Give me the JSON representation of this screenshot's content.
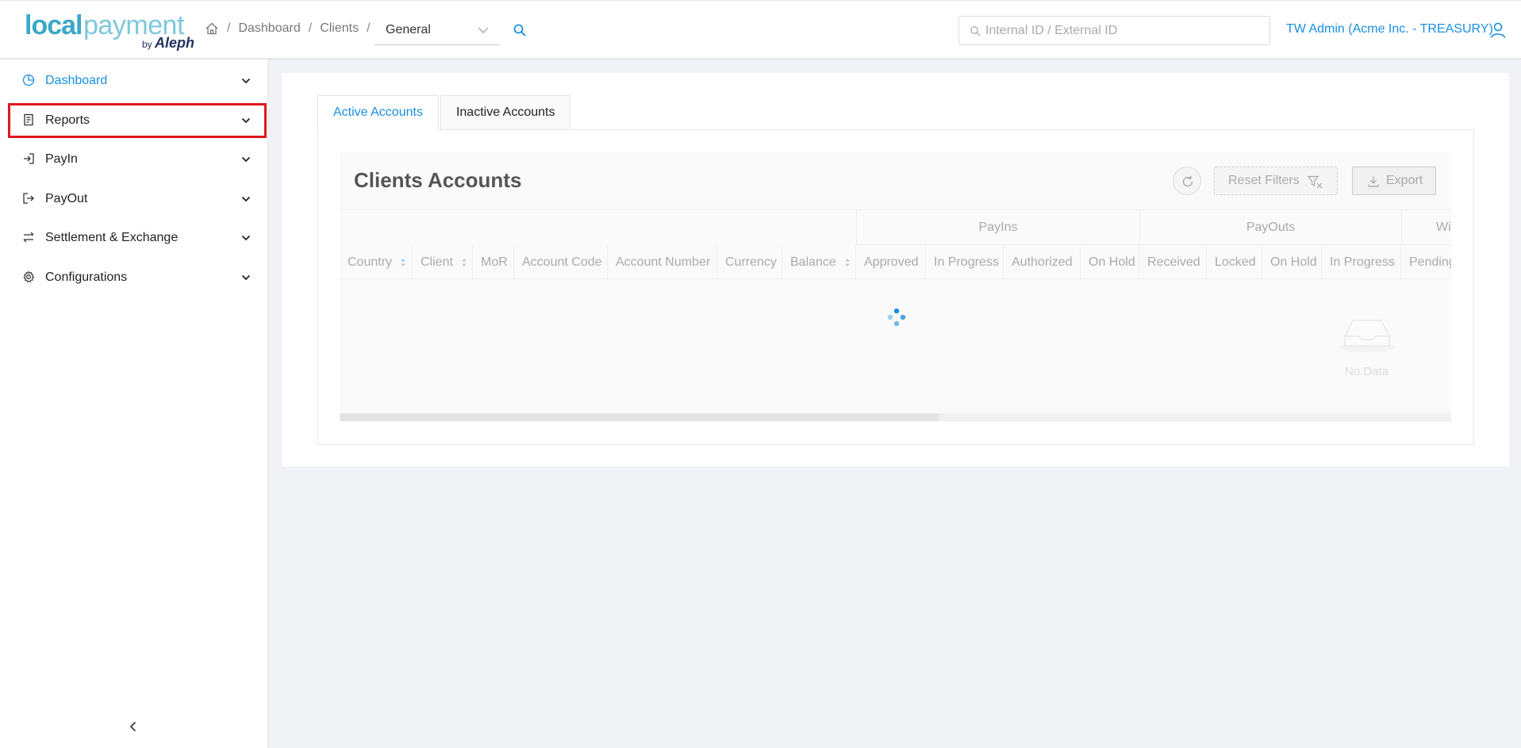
{
  "app": {
    "logo": {
      "local": "local",
      "payment": "payment",
      "by": "by",
      "aleph": "Aleph"
    }
  },
  "header": {
    "breadcrumb": [
      "Dashboard",
      "Clients"
    ],
    "breadcrumb_separator": "/",
    "dropdown_value": "General",
    "id_search_placeholder": "Internal ID / External ID",
    "user": "TW Admin (Acme Inc. - TREASURY)"
  },
  "sidebar": {
    "items": [
      {
        "label": "Dashboard",
        "icon": "pie-chart-icon",
        "active": true
      },
      {
        "label": "Reports",
        "icon": "report-icon",
        "highlighted": true
      },
      {
        "label": "PayIn",
        "icon": "login-icon"
      },
      {
        "label": "PayOut",
        "icon": "logout-icon"
      },
      {
        "label": "Settlement & Exchange",
        "icon": "swap-icon"
      },
      {
        "label": "Configurations",
        "icon": "gear-icon"
      }
    ]
  },
  "tabs": [
    {
      "label": "Active Accounts",
      "active": true
    },
    {
      "label": "Inactive Accounts",
      "active": false
    }
  ],
  "table": {
    "title": "Clients Accounts",
    "reset_filters_label": "Reset Filters",
    "export_label": "Export",
    "group_headers": [
      "PayIns",
      "PayOuts",
      "Wire"
    ],
    "columns": [
      "Country",
      "Client",
      "MoR",
      "Account Code",
      "Account Number",
      "Currency",
      "Balance",
      "Approved",
      "In Progress",
      "Authorized",
      "On Hold",
      "Received",
      "Locked",
      "On Hold",
      "In Progress",
      "Pending"
    ],
    "empty_text": "No Data",
    "loading": true
  },
  "colors": {
    "accent": "#1a8fe3",
    "highlight_border": "#e0161b",
    "logo_primary": "#3ba8c7",
    "logo_secondary": "#7ec8dd",
    "aleph": "#22335f"
  }
}
